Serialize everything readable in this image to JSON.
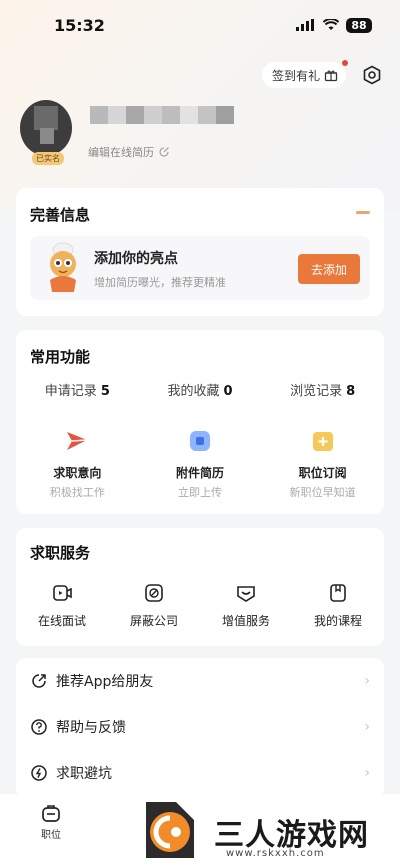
{
  "status_bar": {
    "time": "15:32",
    "battery": "88"
  },
  "header": {
    "checkin_label": "签到有礼"
  },
  "profile": {
    "badge": "已实名",
    "edit_resume": "编辑在线简历"
  },
  "complete_info": {
    "title": "完善信息",
    "highlight_title": "添加你的亮点",
    "highlight_sub": "增加简历曝光，推荐更精准",
    "add_button": "去添加"
  },
  "common_functions": {
    "title": "常用功能",
    "stats": [
      {
        "label": "申请记录",
        "value": "5"
      },
      {
        "label": "我的收藏",
        "value": "0"
      },
      {
        "label": "浏览记录",
        "value": "8"
      }
    ],
    "features": [
      {
        "label": "求职意向",
        "sub": "积极找工作",
        "icon": "send-icon",
        "color": "#e8543f"
      },
      {
        "label": "附件简历",
        "sub": "立即上传",
        "icon": "document-icon",
        "color": "#5b8ff9"
      },
      {
        "label": "职位订阅",
        "sub": "新职位早知道",
        "icon": "subscribe-icon",
        "color": "#f4b83f"
      }
    ]
  },
  "job_services": {
    "title": "求职服务",
    "items": [
      {
        "label": "在线面试",
        "icon": "video-icon"
      },
      {
        "label": "屏蔽公司",
        "icon": "block-icon"
      },
      {
        "label": "增值服务",
        "icon": "service-icon"
      },
      {
        "label": "我的课程",
        "icon": "course-icon"
      }
    ]
  },
  "menu": [
    {
      "label": "推荐App给朋友",
      "icon": "share-icon"
    },
    {
      "label": "帮助与反馈",
      "icon": "help-icon"
    },
    {
      "label": "求职避坑",
      "icon": "warning-icon"
    }
  ],
  "tabbar": {
    "job_label": "职位"
  },
  "watermark": {
    "text": "三人游戏网",
    "url": "www.rskxxh.com"
  }
}
